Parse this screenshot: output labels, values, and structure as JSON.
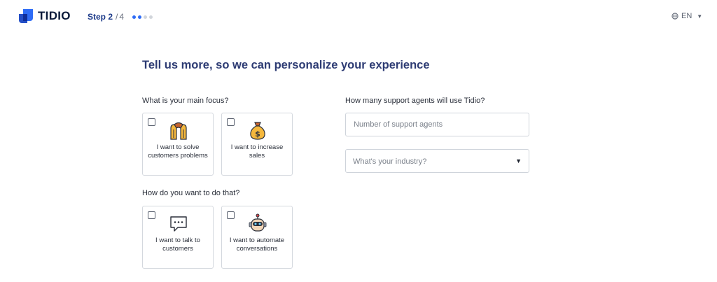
{
  "header": {
    "logo_text": "TIDIO",
    "step_label": "Step 2",
    "step_separator": "/",
    "step_total": "4",
    "progress": {
      "current": 2,
      "total": 4
    },
    "language": "EN"
  },
  "title": "Tell us more, so we can personalize your experience",
  "focus": {
    "question": "What is your main focus?",
    "options": [
      {
        "label": "I want to solve customers problems",
        "icon": "helping-hands-icon",
        "checked": false
      },
      {
        "label": "I want to increase sales",
        "icon": "money-bag-icon",
        "checked": false
      }
    ]
  },
  "method": {
    "question": "How do you want to do that?",
    "options": [
      {
        "label": "I want to talk to customers",
        "icon": "chat-bubble-icon",
        "checked": false
      },
      {
        "label": "I want to automate conversations",
        "icon": "robot-icon",
        "checked": false
      }
    ]
  },
  "agents": {
    "question": "How many support agents will use Tidio?",
    "placeholder": "Number of support agents"
  },
  "industry": {
    "placeholder": "What's your industry?"
  },
  "colors": {
    "brand": "#2e6cf6",
    "title": "#2d3b73",
    "step": "#1d3b8a",
    "border": "#d4d8de"
  }
}
